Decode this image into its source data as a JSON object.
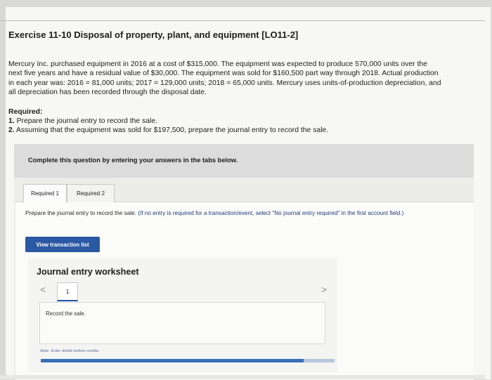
{
  "exercise": {
    "title": "Exercise 11-10 Disposal of property, plant, and equipment [LO11-2]",
    "intro_lines": [
      "Mercury Inc. purchased equipment in 2016 at a cost of $315,000. The equipment was expected to produce 570,000 units over the",
      "next five years and have a residual value of $30,000. The equipment was sold for $160,500 part way through 2018. Actual production",
      "in each year was: 2016 = 81,000 units; 2017 = 129,000 units; 2018 = 65,000 units. Mercury uses units-of-production depreciation, and",
      "all depreciation has been recorded through the disposal date."
    ],
    "required_heading": "Required:",
    "required_1_num": "1.",
    "required_1_text": "Prepare the journal entry to record the sale.",
    "required_2_num": "2.",
    "required_2_text": "Assuming that the equipment was sold for $197,500, prepare the journal entry to record the sale."
  },
  "complete_box": {
    "text": "Complete this question by entering your answers in the tabs below."
  },
  "tabs": [
    {
      "label": "Required 1",
      "active": true
    },
    {
      "label": "Required 2",
      "active": false
    }
  ],
  "instruction": {
    "text": "Prepare the journal entry to record the sale.",
    "note": "(If no entry is required for a transaction/event, select \"No journal entry required\" in the first account field.)"
  },
  "view_button_label": "View transaction list",
  "worksheet": {
    "title": "Journal entry worksheet",
    "page": "1",
    "prev_icon": "<",
    "next_icon": ">",
    "record_text": "Record the sale.",
    "note": "Note: Enter debits before credits."
  }
}
